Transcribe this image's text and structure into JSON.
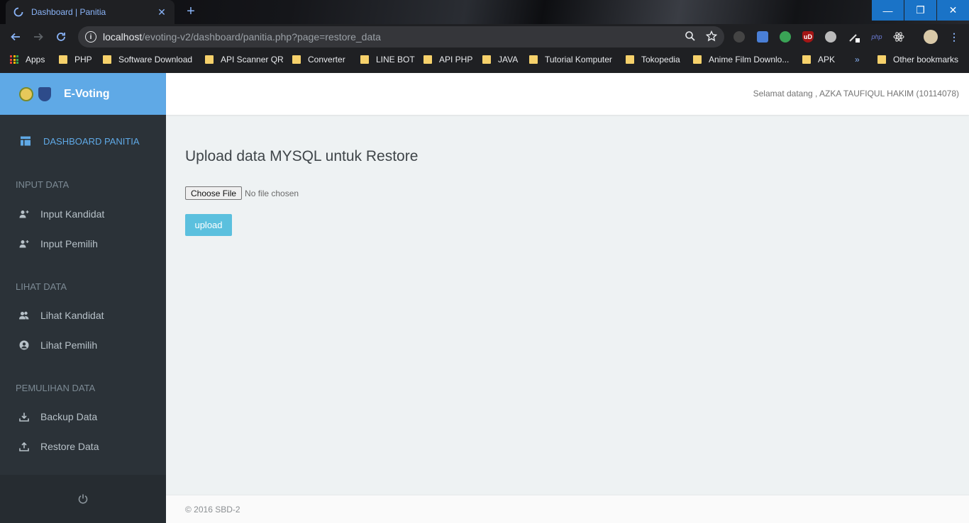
{
  "browser": {
    "tab": {
      "title": "Dashboard | Panitia",
      "close": "✕"
    },
    "new_tab": "+",
    "window": {
      "minimize": "—",
      "maximize": "❐",
      "close": "✕"
    },
    "url": {
      "host": "localhost",
      "path": "/evoting-v2/dashboard/panitia.php?page=restore_data"
    },
    "bookmarks": [
      "Apps",
      "PHP",
      "Software Download",
      "API Scanner QR",
      "Converter",
      "LINE BOT",
      "API PHP",
      "JAVA",
      "Tutorial Komputer",
      "Tokopedia",
      "Anime Film Downlo...",
      "APK",
      "»",
      "Other bookmarks"
    ],
    "extensions": [
      "globe-ext-icon",
      "google-translate-icon",
      "earth-ext-icon",
      "ublock-icon",
      "world-ext-icon",
      "pen-ext-icon",
      "php-ext-icon",
      "react-devtools-icon",
      "profile-avatar-icon",
      "menu-dots-icon"
    ],
    "extension_labels": {
      "php": "php",
      "ublock": "uD"
    }
  },
  "app": {
    "brand": "E-Voting",
    "welcome": "Selamat datang , AZKA TAUFIQUL HAKIM (10114078)",
    "sidebar": {
      "active": "DASHBOARD PANITIA",
      "sections": [
        {
          "title": "INPUT DATA",
          "items": [
            "Input Kandidat",
            "Input Pemilih"
          ]
        },
        {
          "title": "LIHAT DATA",
          "items": [
            "Lihat Kandidat",
            "Lihat Pemilih"
          ]
        },
        {
          "title": "PEMULIHAN DATA",
          "items": [
            "Backup Data",
            "Restore Data"
          ]
        }
      ]
    },
    "main": {
      "heading": "Upload data MYSQL untuk Restore",
      "file_button": "Choose File",
      "file_status": "No file chosen",
      "upload_button": "upload"
    },
    "footer": "© 2016 SBD-2"
  },
  "colors": {
    "brand": "#5fa9e6",
    "sidebar": "#2b3238",
    "upload": "#5bc0de",
    "tab_text": "#8ab4f8"
  }
}
